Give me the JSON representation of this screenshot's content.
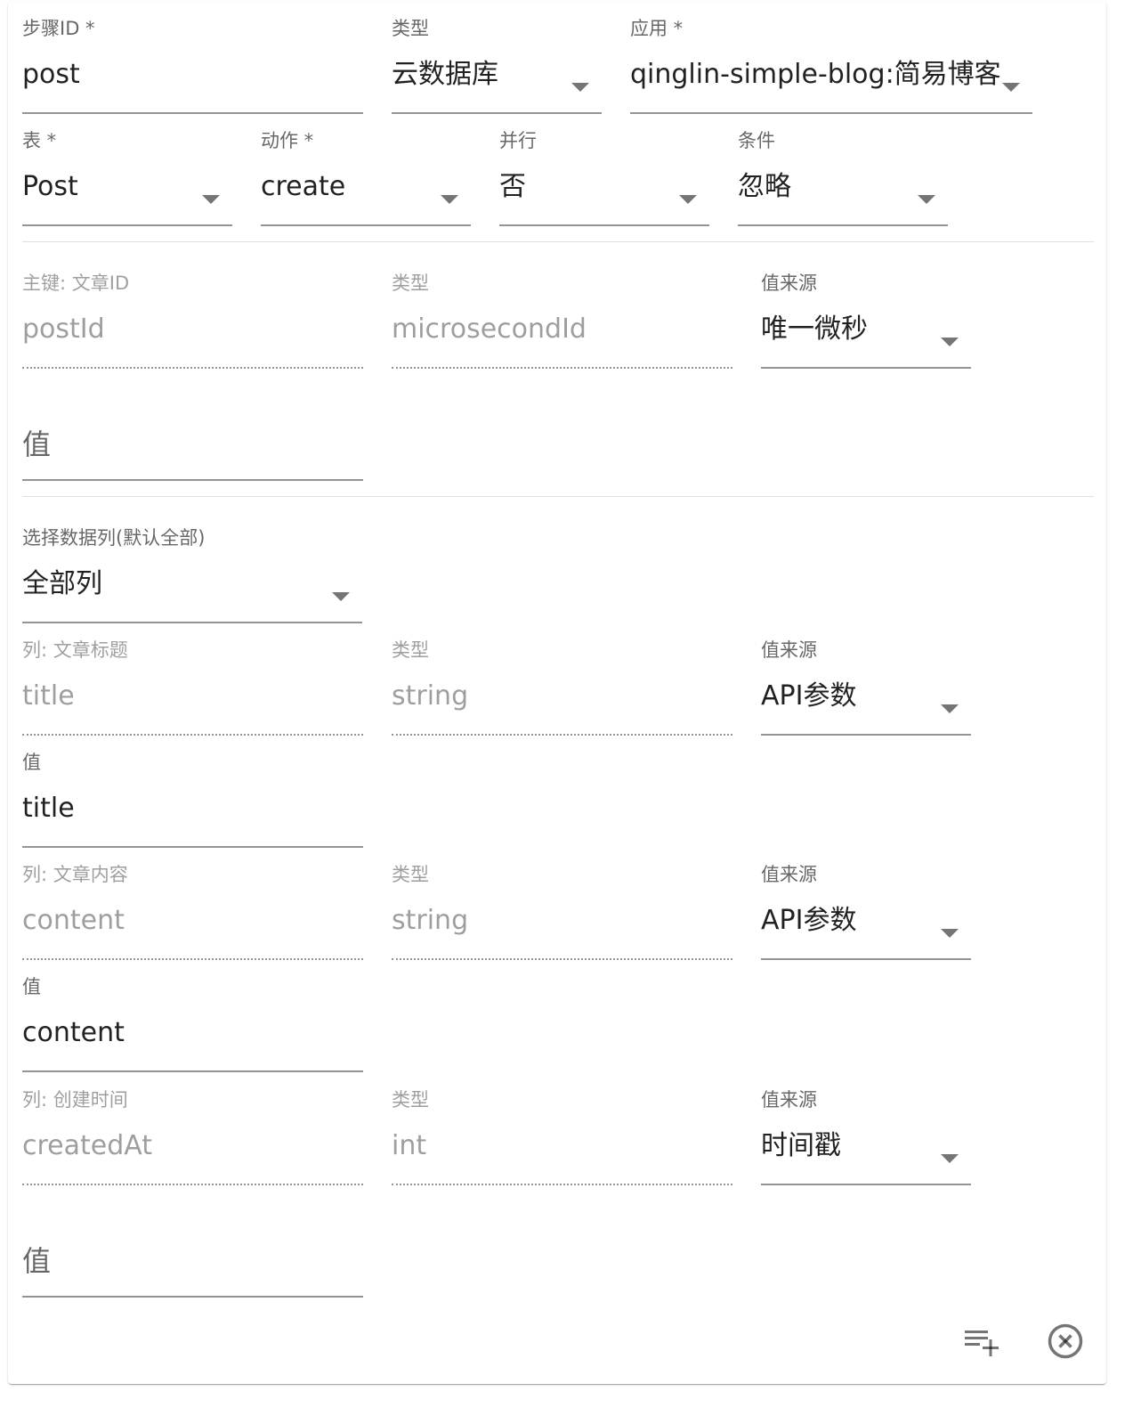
{
  "step": {
    "step_id": {
      "label": "步骤ID *",
      "value": "post"
    },
    "type": {
      "label": "类型",
      "value": "云数据库"
    },
    "app": {
      "label": "应用 *",
      "value": "qinglin-simple-blog:简易博客"
    },
    "table": {
      "label": "表 *",
      "value": "Post"
    },
    "action": {
      "label": "动作 *",
      "value": "create"
    },
    "parallel": {
      "label": "并行",
      "value": "否"
    },
    "condition": {
      "label": "条件",
      "value": "忽略"
    }
  },
  "primary_key": {
    "name_label": "主键: 文章ID",
    "name_value": "postId",
    "type_label": "类型",
    "type_value": "microsecondId",
    "source_label": "值来源",
    "source_value": "唯一微秒",
    "value_placeholder": "值"
  },
  "columns_select": {
    "label": "选择数据列(默认全部)",
    "value": "全部列"
  },
  "columns": [
    {
      "name_label": "列: 文章标题",
      "name_value": "title",
      "type_label": "类型",
      "type_value": "string",
      "source_label": "值来源",
      "source_value": "API参数",
      "value_label": "值",
      "value": "title"
    },
    {
      "name_label": "列: 文章内容",
      "name_value": "content",
      "type_label": "类型",
      "type_value": "string",
      "source_label": "值来源",
      "source_value": "API参数",
      "value_label": "值",
      "value": "content"
    },
    {
      "name_label": "列: 创建时间",
      "name_value": "createdAt",
      "type_label": "类型",
      "type_value": "int",
      "source_label": "值来源",
      "source_value": "时间戳",
      "value_placeholder": "值"
    }
  ],
  "actions": {
    "add_icon": "playlist-add-icon",
    "remove_icon": "close-circle-outline-icon"
  }
}
